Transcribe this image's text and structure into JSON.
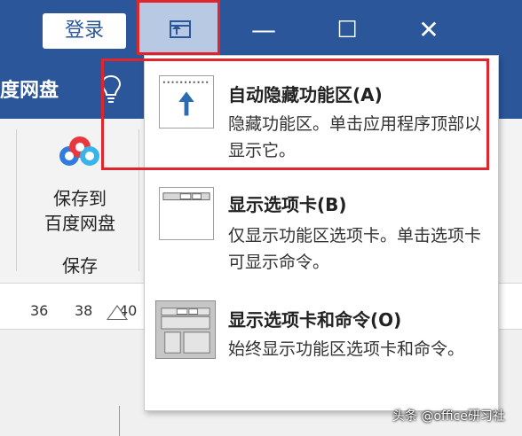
{
  "titlebar": {
    "login_label": "登录",
    "minimize_label": "—",
    "maximize_label": "☐",
    "close_label": "✕"
  },
  "tabs": {
    "baidu_tab_label": "度网盘"
  },
  "ribbon": {
    "save_to_line1": "保存到",
    "save_to_line2": "百度网盘",
    "group_label": "保存"
  },
  "ruler": {
    "ticks": [
      "36",
      "38",
      "40"
    ]
  },
  "menu": {
    "items": [
      {
        "title": "自动隐藏功能区(A)",
        "desc": "隐藏功能区。单击应用程序顶部以显示它。"
      },
      {
        "title": "显示选项卡(B)",
        "desc": "仅显示功能区选项卡。单击选项卡可显示命令。"
      },
      {
        "title": "显示选项卡和命令(O)",
        "desc": "始终显示功能区选项卡和命令。"
      }
    ]
  },
  "watermark": "头条 @office研习社",
  "colors": {
    "titlebar": "#2b579a",
    "highlight": "#e1252d",
    "arrow": "#2b6cb0"
  }
}
